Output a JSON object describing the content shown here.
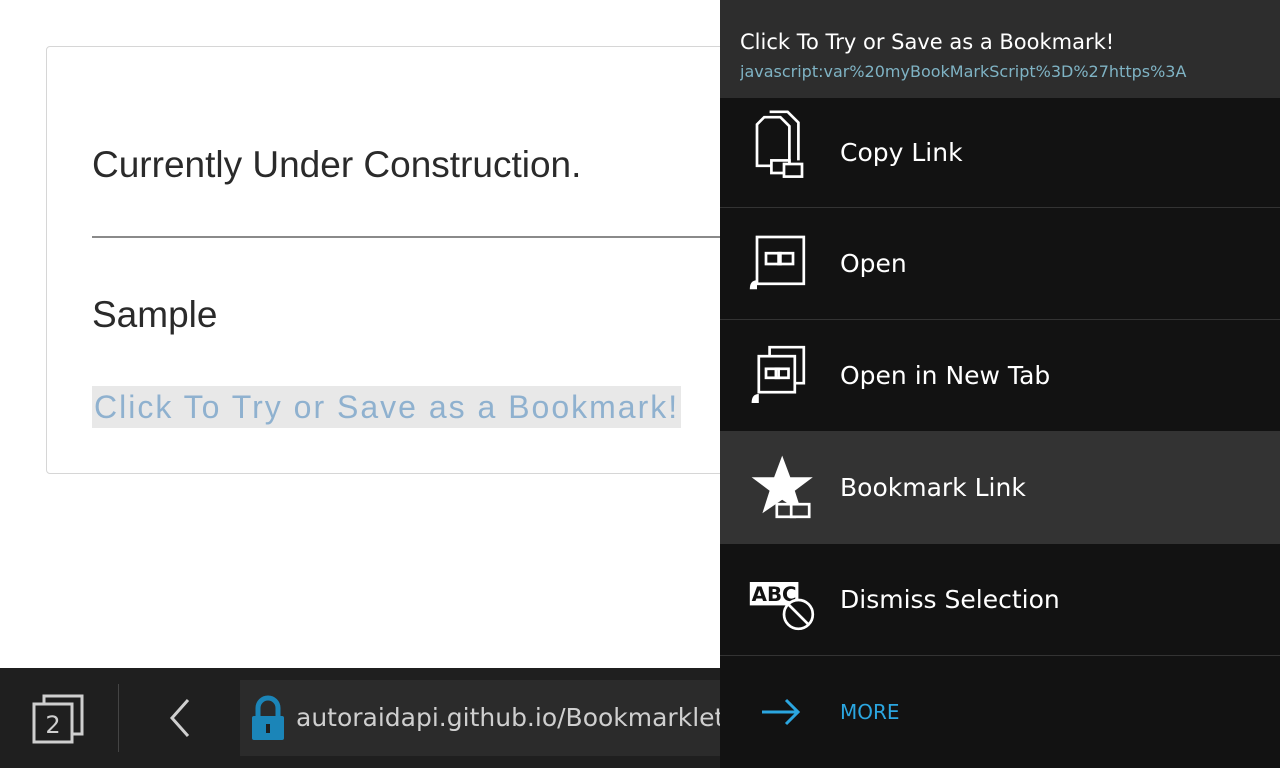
{
  "page": {
    "heading": "Currently Under Construction.",
    "subheading": "Sample",
    "bookmarklet_link": "Click To Try or Save as a Bookmark!"
  },
  "bottombar": {
    "tab_count": "2",
    "url": "autoraidapi.github.io/Bookmarklet"
  },
  "context_menu": {
    "title": "Click To Try or Save as a Bookmark!",
    "url": "javascript:var%20myBookMarkScript%3D%27https%3A",
    "items": [
      {
        "label": "Copy Link",
        "icon": "copy-link-icon"
      },
      {
        "label": "Open",
        "icon": "open-link-icon"
      },
      {
        "label": "Open in New Tab",
        "icon": "open-new-tab-icon"
      },
      {
        "label": "Bookmark Link",
        "icon": "bookmark-star-icon"
      },
      {
        "label": "Dismiss Selection",
        "icon": "dismiss-selection-icon"
      }
    ],
    "more_label": "MORE"
  },
  "colors": {
    "panel_bg": "#121212",
    "header_bg": "#2d2d2d",
    "highlight_bg": "#333333",
    "accent": "#2ba6e0",
    "link_text": "#8fb1cf"
  }
}
